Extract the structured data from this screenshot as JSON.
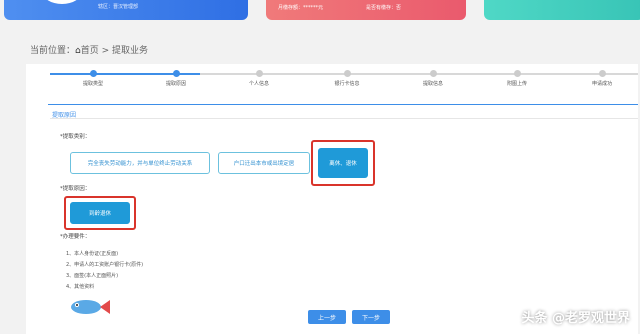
{
  "header": {
    "org_label": "辖区：晋汉管理部",
    "balance_label": "月缴存额：******元",
    "status_label": "是否有缴存：否"
  },
  "breadcrumb": {
    "prefix": "当前位置：",
    "home": "首页",
    "sep": " > ",
    "current": "提取业务"
  },
  "steps": [
    "提取类型",
    "提取原因",
    "个人信息",
    "银行卡信息",
    "提取信息",
    "附图上传",
    "申请成功"
  ],
  "section_title": "提取原因",
  "extract_type": {
    "label": "*提取类别：",
    "options": [
      "完全丧失劳动能力，并与单位终止劳动关系",
      "户口迁出本市或出境定居",
      "离休、退休"
    ]
  },
  "extract_reason": {
    "label": "*提取原因：",
    "option": "到龄退休"
  },
  "requirements": {
    "label": "*办理要件：",
    "items": [
      "1、本人身份证(正反面)",
      "2、申请人的工资账户银行卡(原件)",
      "3、面签(本人正面照片)",
      "4、其他资料"
    ]
  },
  "nav": {
    "prev": "上一步",
    "next": "下一步"
  },
  "watermark": "头条 @老罗观世界",
  "colors": {
    "accent": "#3d8ee8",
    "selected": "#1f9ad8",
    "highlight": "#d9342b"
  }
}
